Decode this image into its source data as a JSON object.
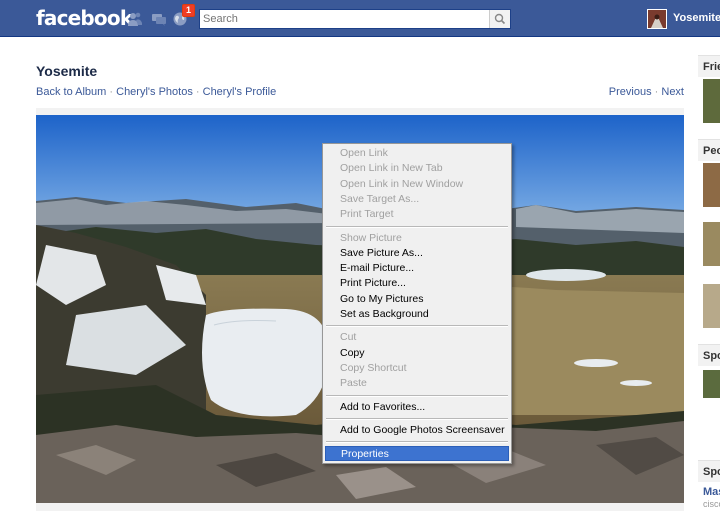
{
  "header": {
    "logo": "facebook",
    "notification_count": "1",
    "search_placeholder": "Search",
    "user_name": "Yosemite"
  },
  "album": {
    "title": "Yosemite",
    "breadcrumbs": [
      "Back to Album",
      "Cheryl's Photos",
      "Cheryl's Profile"
    ],
    "separator": "·",
    "prev_label": "Previous",
    "next_label": "Next"
  },
  "context_menu": {
    "items": [
      {
        "label": "Open Link",
        "enabled": false
      },
      {
        "label": "Open Link in New Tab",
        "enabled": false
      },
      {
        "label": "Open Link in New Window",
        "enabled": false
      },
      {
        "label": "Save Target As...",
        "enabled": false
      },
      {
        "label": "Print Target",
        "enabled": false
      },
      {
        "separator": true
      },
      {
        "label": "Show Picture",
        "enabled": false
      },
      {
        "label": "Save Picture As...",
        "enabled": true
      },
      {
        "label": "E-mail Picture...",
        "enabled": true
      },
      {
        "label": "Print Picture...",
        "enabled": true
      },
      {
        "label": "Go to My Pictures",
        "enabled": true
      },
      {
        "label": "Set as Background",
        "enabled": true
      },
      {
        "separator": true
      },
      {
        "label": "Cut",
        "enabled": false
      },
      {
        "label": "Copy",
        "enabled": true
      },
      {
        "label": "Copy Shortcut",
        "enabled": false
      },
      {
        "label": "Paste",
        "enabled": false
      },
      {
        "separator": true
      },
      {
        "label": "Add to Favorites...",
        "enabled": true
      },
      {
        "separator": true
      },
      {
        "label": "Add to Google Photos Screensaver",
        "enabled": true
      },
      {
        "separator": true
      },
      {
        "label": "Properties",
        "enabled": true,
        "highlighted": true
      }
    ]
  },
  "right_column": {
    "headers": [
      "Frie",
      "Peo",
      "Spo",
      "Spo"
    ],
    "link": "Mas",
    "sub": "cisco"
  },
  "colors": {
    "brand_blue": "#3b5998",
    "highlight": "#3d73d0",
    "badge_red": "#f03d25"
  },
  "icons": [
    "friend-requests-icon",
    "messages-icon",
    "notifications-globe-icon",
    "magnifier-icon"
  ]
}
